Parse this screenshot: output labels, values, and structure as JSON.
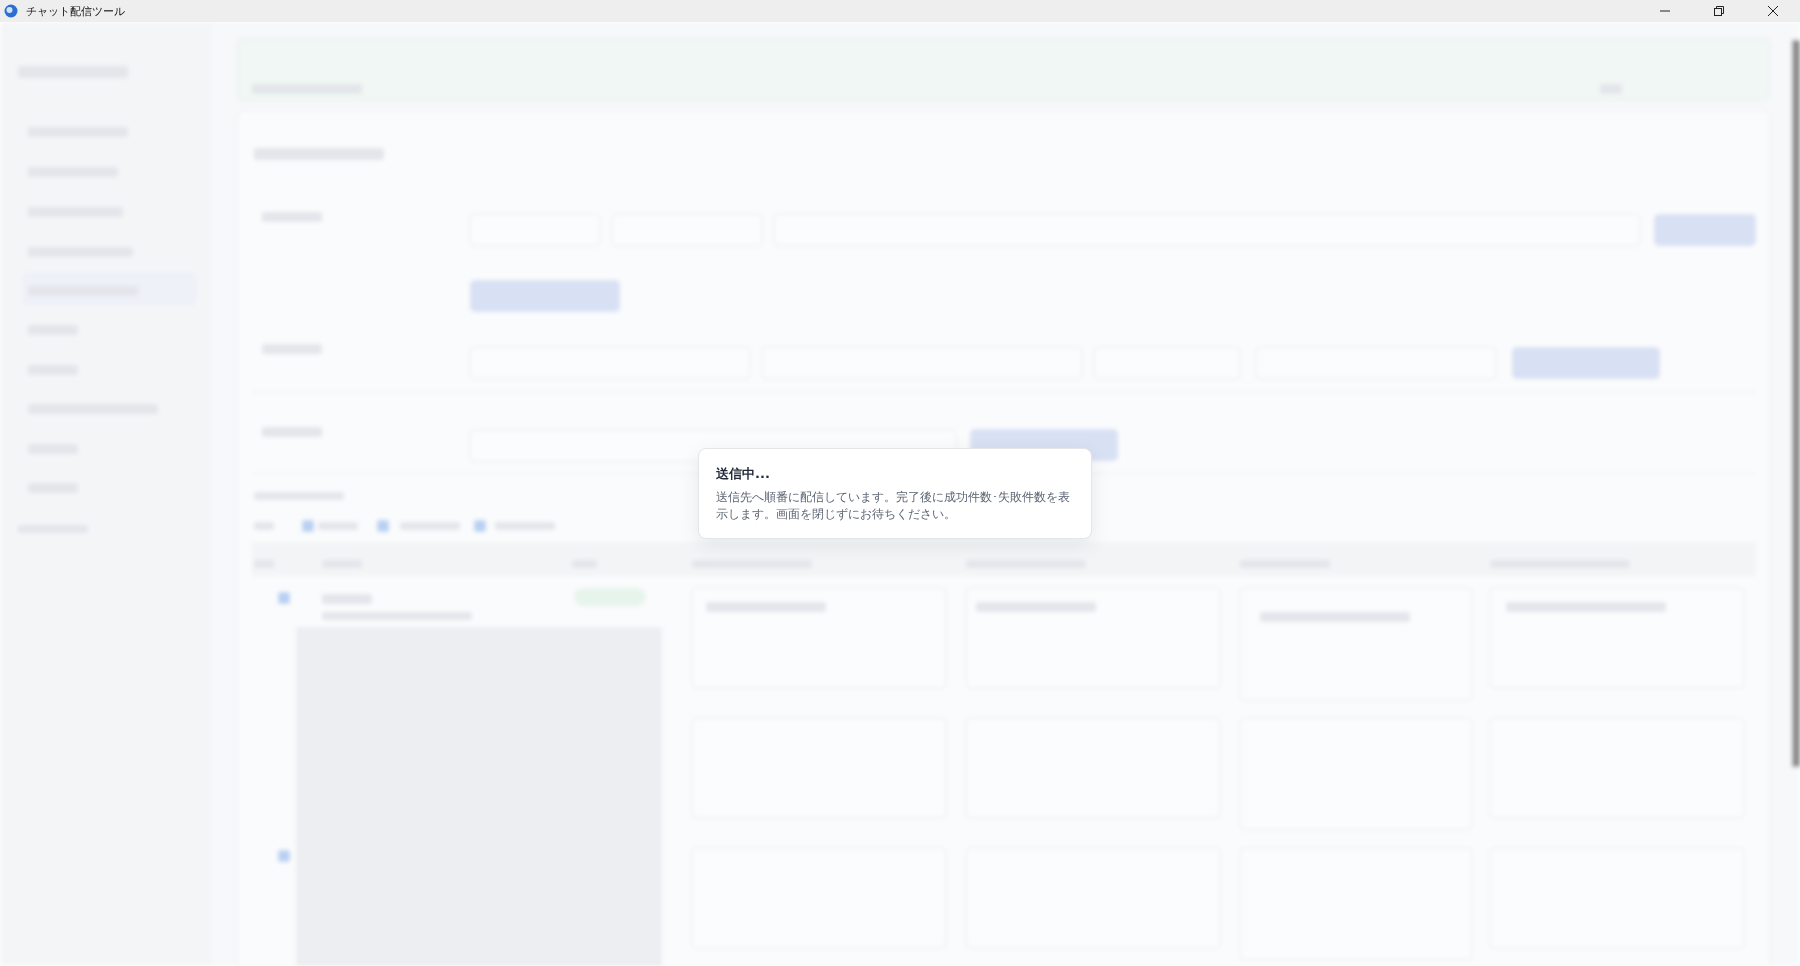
{
  "window": {
    "title": "チャット配信ツール"
  },
  "dialog": {
    "title": "送信中...",
    "message": "送信先へ順番に配信しています。完了後に成功件数･失敗件数を表示します。画面を閉じずにお待ちください。"
  }
}
